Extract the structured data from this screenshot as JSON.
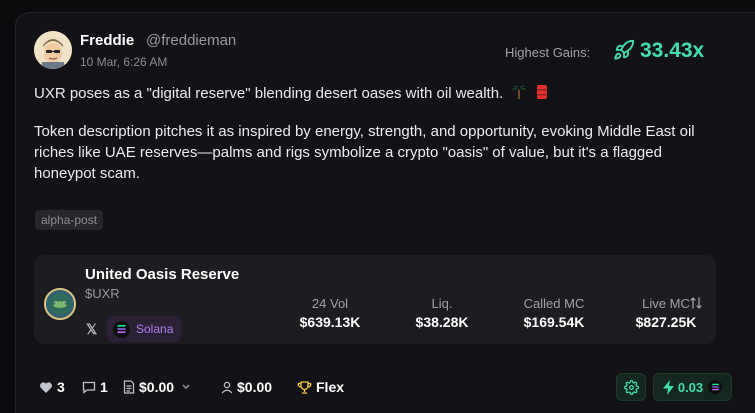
{
  "post": {
    "author_name": "Freddie",
    "author_handle": "@freddieman",
    "date": "10 Mar, 6:26 AM",
    "highest_gains_label": "Highest Gains:",
    "highest_gains_value": "33.43x",
    "paragraph1": "UXR poses as a \"digital reserve\" blending desert oases with oil wealth.",
    "paragraph2": "Token description pitches it as inspired by energy, strength, and opportunity, evoking Middle East oil riches like UAE reserves—palms and rigs symbolize a crypto \"oasis\" of value, but it's a flagged honeypot scam.",
    "tag": "alpha-post"
  },
  "token": {
    "name": "United Oasis Reserve",
    "symbol": "$UXR",
    "chain": "Solana",
    "stats": [
      {
        "label": "24 Vol",
        "value": "$639.13K"
      },
      {
        "label": "Liq.",
        "value": "$38.28K"
      },
      {
        "label": "Called MC",
        "value": "$169.54K"
      },
      {
        "label": "Live MC",
        "value": "$827.25K"
      }
    ]
  },
  "footer": {
    "likes": "3",
    "comments": "1",
    "tip_amount": "$0.00",
    "user_amount": "$0.00",
    "flex_label": "Flex",
    "boost_value": "0.03"
  },
  "colors": {
    "accent": "#3fe0b0",
    "solana_purple": "#b07ef7",
    "card_bg": "#131317"
  }
}
